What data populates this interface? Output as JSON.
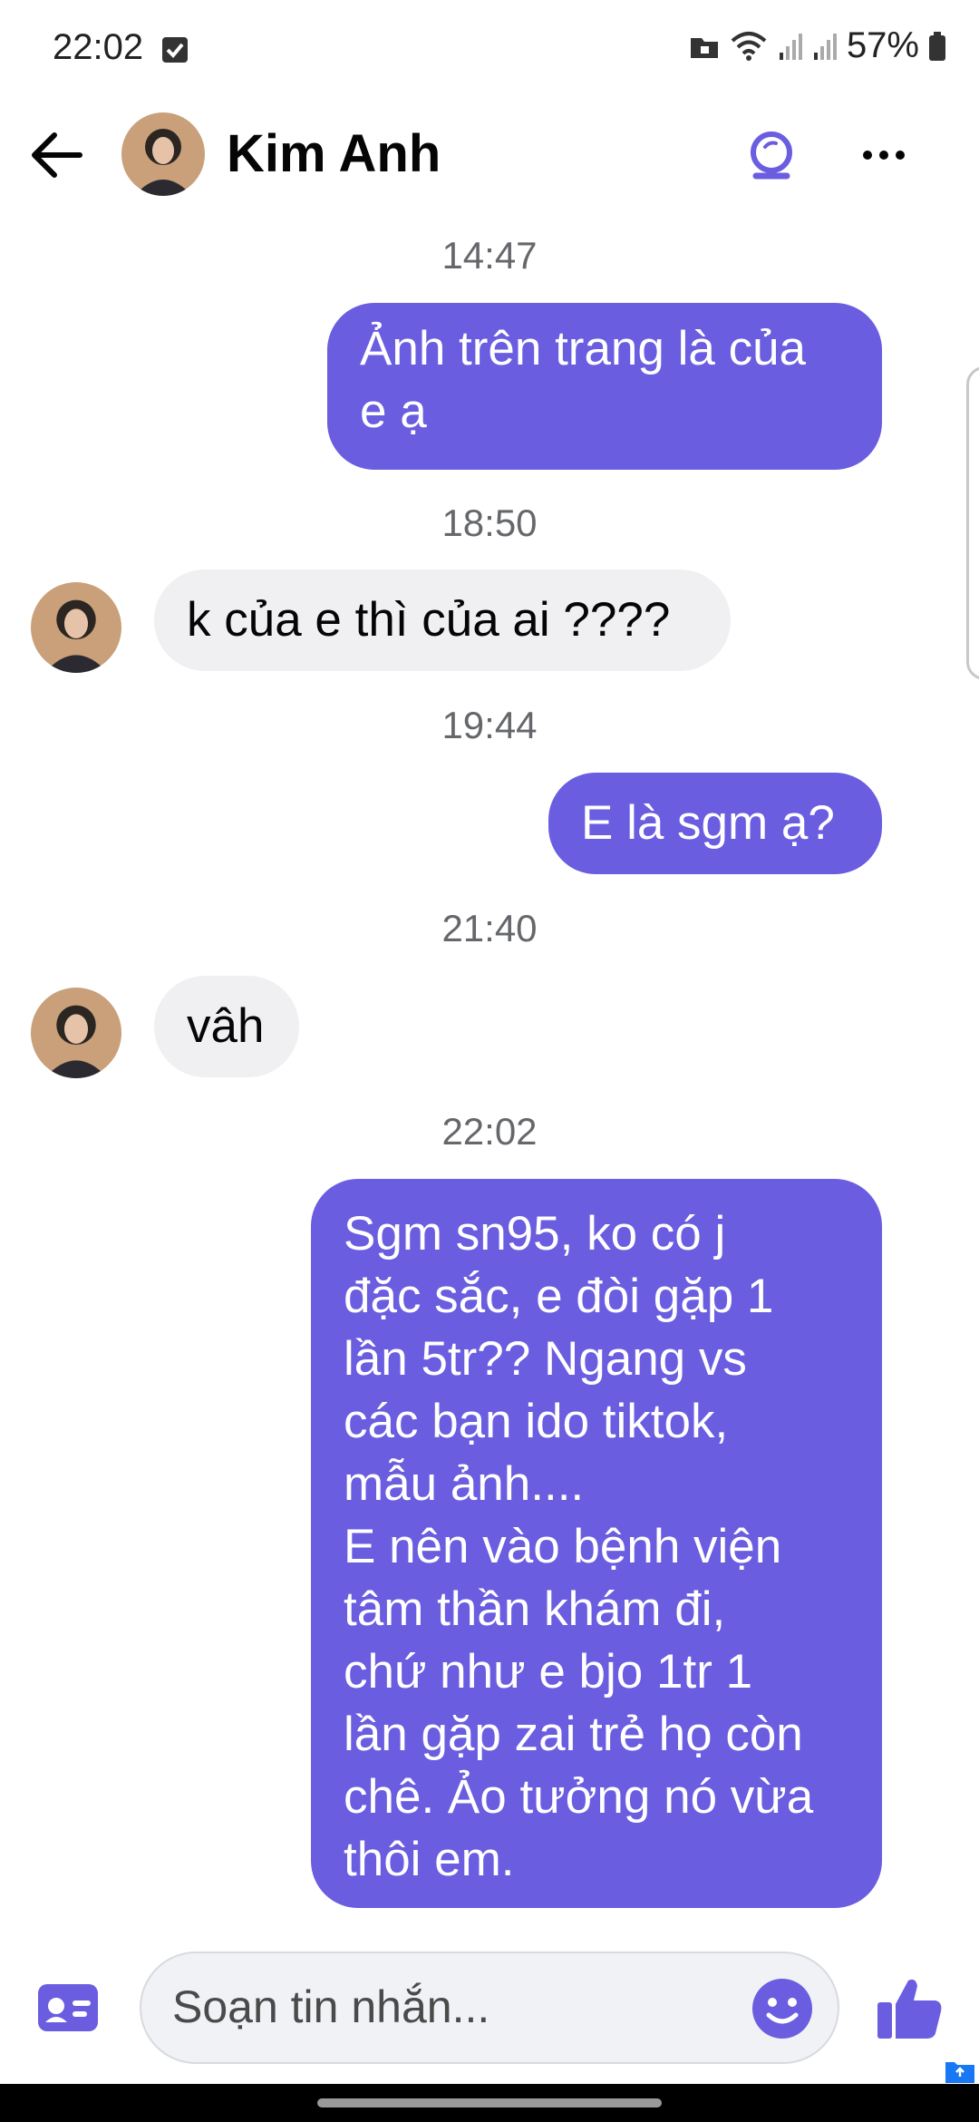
{
  "status_bar": {
    "time": "22:02",
    "battery_percent": "57%",
    "icons": [
      "check-notification-icon",
      "folder-lock-icon",
      "wifi-icon",
      "signal-icon",
      "signal-icon",
      "battery-icon"
    ]
  },
  "header": {
    "contact_name": "Kim Anh",
    "back_icon": "arrow-left-icon",
    "call_icon": "video-call-icon",
    "more_icon": "more-dots-icon"
  },
  "messages": [
    {
      "timestamp": "14:47",
      "direction": "outgoing",
      "text": "Ảnh trên trang là của\ne ạ"
    },
    {
      "timestamp": "18:50",
      "direction": "incoming",
      "text": "k của e thì của ai ????"
    },
    {
      "timestamp": "19:44",
      "direction": "outgoing",
      "text": "E là sgm ạ?"
    },
    {
      "timestamp": "21:40",
      "direction": "incoming",
      "text": "vâh"
    },
    {
      "timestamp": "22:02",
      "direction": "outgoing",
      "text": "Sgm sn95, ko có j\nđặc sắc, e đòi gặp 1\nlần 5tr?? Ngang vs\ncác bạn ido tiktok,\nmẫu ảnh....\nE nên vào bệnh viện\ntâm thần khám đi,\nchứ như e bjo 1tr 1\nlần gặp zai trẻ họ còn\nchê. Ảo tưởng nó vừa\nthôi em."
    }
  ],
  "composer": {
    "placeholder": "Soạn tin nhắn...",
    "left_icon": "contact-card-icon",
    "emoji_icon": "emoji-icon",
    "send_icon": "thumbs-up-icon"
  },
  "colors": {
    "outgoing_bubble": "#6a5de0",
    "incoming_bubble": "#f0f0f3",
    "accent": "#6a5de0",
    "timestamp": "#65676b"
  }
}
